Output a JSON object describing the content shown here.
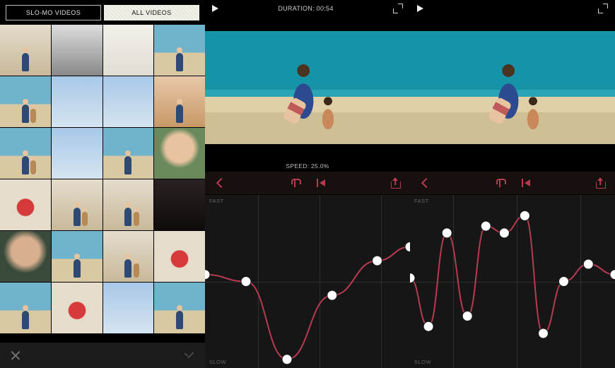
{
  "panel_left": {
    "tabs": [
      {
        "id": "slomo",
        "label": "SLO-MO VIDEOS",
        "active": false
      },
      {
        "id": "all",
        "label": "ALL VIDEOS",
        "active": true
      }
    ],
    "thumbnails": [
      {
        "style": "indoor"
      },
      {
        "style": "bw"
      },
      {
        "style": "pale"
      },
      {
        "style": "beach"
      },
      {
        "style": "beach"
      },
      {
        "style": "sky"
      },
      {
        "style": "sky"
      },
      {
        "style": "warm"
      },
      {
        "style": "beach"
      },
      {
        "style": "sky"
      },
      {
        "style": "beach"
      },
      {
        "style": "face"
      },
      {
        "style": "red"
      },
      {
        "style": "indoor"
      },
      {
        "style": "indoor"
      },
      {
        "style": "dark"
      },
      {
        "style": "face2"
      },
      {
        "style": "beach"
      },
      {
        "style": "indoor"
      },
      {
        "style": "red"
      },
      {
        "style": "beach"
      },
      {
        "style": "red"
      },
      {
        "style": "sky"
      },
      {
        "style": "beach"
      }
    ],
    "footer": {
      "cancel": "cancel",
      "confirm": "confirm"
    }
  },
  "panel_mid": {
    "duration_label": "DURATION: 00:54",
    "speed_label": "SPEED: 25.0%",
    "axis_fast": "FAST",
    "axis_slow": "SLOW",
    "grid_v": [
      0.26,
      0.56,
      0.86
    ],
    "grid_h": [
      0.5
    ],
    "curve": {
      "accent": "#b83a52",
      "points": [
        {
          "x": 0.0,
          "y": 0.46
        },
        {
          "x": 0.2,
          "y": 0.5
        },
        {
          "x": 0.4,
          "y": 0.95
        },
        {
          "x": 0.62,
          "y": 0.58
        },
        {
          "x": 0.84,
          "y": 0.38
        },
        {
          "x": 1.0,
          "y": 0.3
        }
      ]
    },
    "toolbar": {
      "back": "back",
      "reset": "reset",
      "skip": "skip-start",
      "share": "share"
    }
  },
  "panel_right": {
    "axis_fast": "FAST",
    "axis_slow": "SLOW",
    "grid_v": [
      0.21,
      0.52,
      0.83
    ],
    "grid_h": [
      0.5
    ],
    "curve": {
      "accent": "#b83a52",
      "points": [
        {
          "x": 0.0,
          "y": 0.48
        },
        {
          "x": 0.09,
          "y": 0.76
        },
        {
          "x": 0.18,
          "y": 0.22
        },
        {
          "x": 0.28,
          "y": 0.7
        },
        {
          "x": 0.37,
          "y": 0.18
        },
        {
          "x": 0.46,
          "y": 0.22
        },
        {
          "x": 0.56,
          "y": 0.12
        },
        {
          "x": 0.65,
          "y": 0.8
        },
        {
          "x": 0.75,
          "y": 0.5
        },
        {
          "x": 0.87,
          "y": 0.4
        },
        {
          "x": 1.0,
          "y": 0.46
        }
      ]
    },
    "toolbar": {
      "back": "back",
      "reset": "reset",
      "skip": "skip-start",
      "share": "share"
    }
  }
}
